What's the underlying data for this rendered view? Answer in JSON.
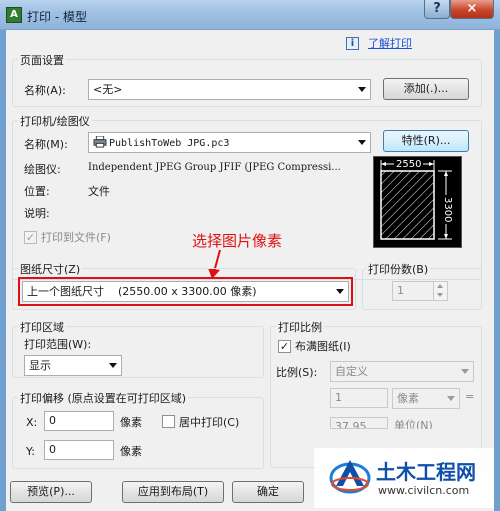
{
  "window": {
    "icon_text": "A",
    "title": "打印 - 模型",
    "help_label": "?",
    "close_label": "×"
  },
  "header": {
    "info_icon": "i",
    "learn_link": "了解打印"
  },
  "page_setup": {
    "title": "页面设置",
    "name_label": "名称(A):",
    "name_value": "<无>",
    "add_button": "添加(.)..."
  },
  "printer": {
    "title": "打印机/绘图仪",
    "name_label": "名称(M):",
    "name_value": "PublishToWeb JPG.pc3",
    "properties_button": "特性(R)...",
    "plotter_label": "绘图仪:",
    "plotter_value": "Independent JPEG Group JFIF (JPEG Compressi...",
    "location_label": "位置:",
    "location_value": "文件",
    "description_label": "说明:",
    "print_to_file_label": "打印到文件(F)",
    "print_to_file_checked": true
  },
  "preview": {
    "width_dim": "2550",
    "height_dim": "3300"
  },
  "annotation": {
    "text": "选择图片像素",
    "color": "#e01010"
  },
  "paper_size": {
    "title": "图纸尺寸(Z)",
    "value": "上一个图纸尺寸    (2550.00 x 3300.00 像素)"
  },
  "copies": {
    "title": "打印份数(B)",
    "value": "1"
  },
  "plot_area": {
    "title": "打印区域",
    "range_label": "打印范围(W):",
    "range_value": "显示"
  },
  "plot_scale": {
    "title": "打印比例",
    "fit_label": "布满图纸(I)",
    "fit_checked": true,
    "scale_label": "比例(S):",
    "scale_value": "自定义",
    "value1": "1",
    "unit": "像素",
    "equals": "=",
    "value2": "37.95",
    "unit2": "单位(N)"
  },
  "plot_offset": {
    "title": "打印偏移 (原点设置在可打印区域)",
    "x_label": "X:",
    "x_value": "0",
    "x_unit": "像素",
    "center_label": "居中打印(C)",
    "center_checked": false,
    "y_label": "Y:",
    "y_value": "0",
    "y_unit": "像素"
  },
  "footer": {
    "preview_button": "预览(P)...",
    "apply_button": "应用到布局(T)",
    "ok_button": "确定"
  },
  "watermark": {
    "logo_text": "土木工程网",
    "url": "www.civilcn.com"
  }
}
